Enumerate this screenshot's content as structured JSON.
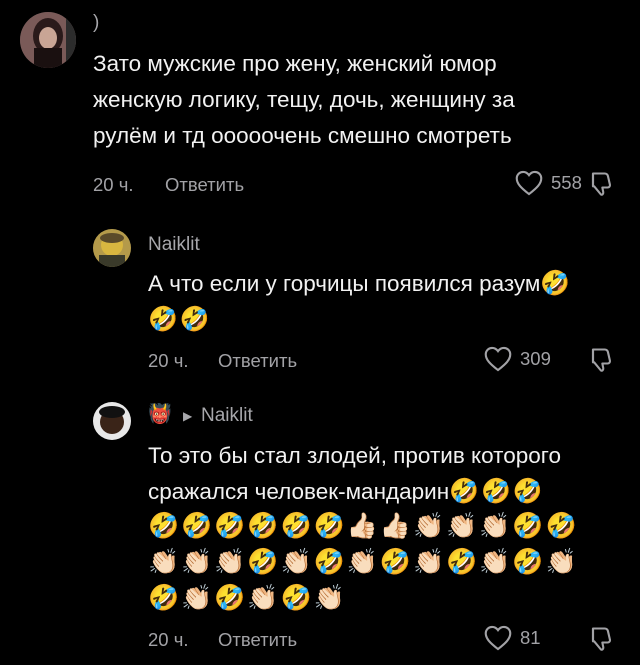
{
  "comment1": {
    "author": ")",
    "lines": [
      "Зато мужские про жену, женский юмор",
      "женскую логику, тещу, дочь, женщину за",
      "рулём и тд ооооочень смешно смотреть"
    ],
    "time": "20 ч.",
    "reply_label": "Ответить",
    "likes": "558",
    "avatar_icon": "avatar-dark-haired-woman"
  },
  "comment2": {
    "author": "Naiklit",
    "line1": "А что если у горчицы появился разум",
    "line1_emoji": "🤣",
    "line2_emoji": "🤣🤣",
    "time": "20 ч.",
    "reply_label": "Ответить",
    "likes": "309",
    "avatar_icon": "avatar-mustard-character"
  },
  "comment3": {
    "author_emoji": "👹",
    "reply_to": "Naiklit",
    "line1": "То это бы стал злодей, против которого",
    "line2": "сражался человек-мандарин",
    "line2_emoji": "🤣🤣🤣",
    "emoji_row1": "🤣🤣🤣🤣🤣🤣👍🏻👍🏻👏🏻👏🏻👏🏻🤣🤣",
    "emoji_row2": "👏🏻👏🏻👏🏻🤣👏🏻🤣👏🏻🤣👏🏻🤣👏🏻🤣👏🏻",
    "emoji_row3": "🤣👏🏻🤣👏🏻🤣👏🏻",
    "time": "20 ч.",
    "reply_label": "Ответить",
    "likes": "81",
    "avatar_icon": "avatar-round-face"
  }
}
